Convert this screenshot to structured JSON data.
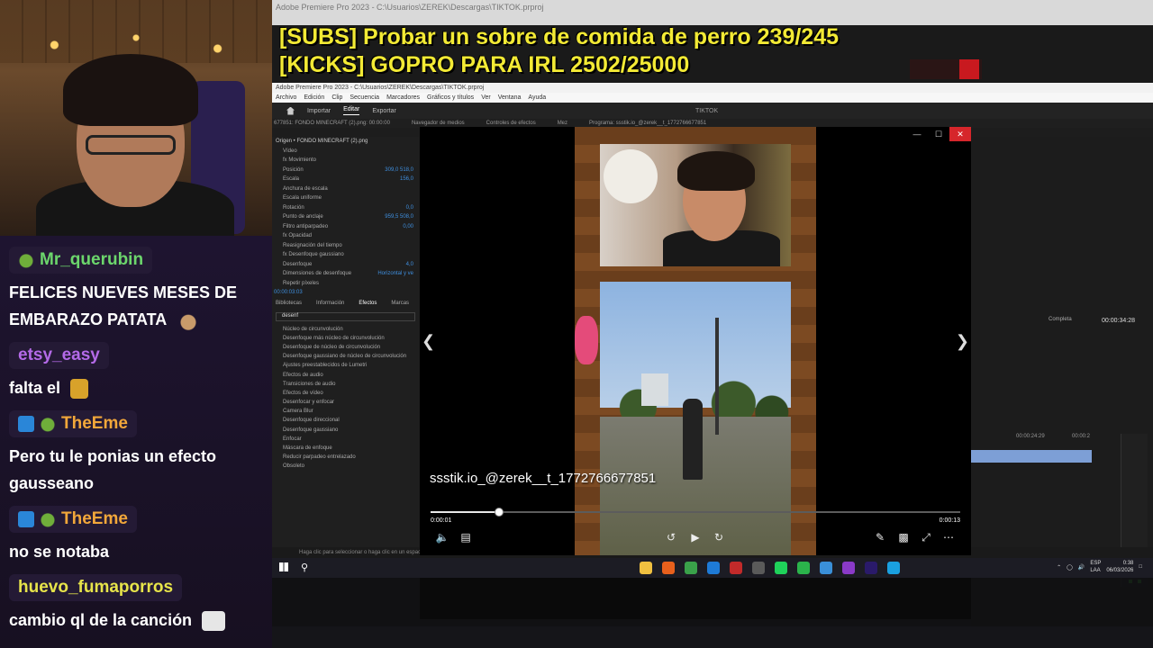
{
  "alerts": {
    "line1": "[SUBS] Probar un sobre de comida de perro 239/245",
    "line2": "[KICKS] GOPRO PARA IRL 2502/25000"
  },
  "chat": {
    "messages": [
      {
        "user": "Mr_querubin",
        "color": "#6cd66c",
        "badges": [
          "frog"
        ],
        "text": "FELICES NUEVES MESES DE EMBARAZO PATATA"
      },
      {
        "user": "etsy_easy",
        "color": "#b46ae8",
        "badges": [],
        "text": "falta el"
      },
      {
        "user": "TheEme",
        "color": "#f2a73a",
        "badges": [
          "prime",
          "frog"
        ],
        "text": "Pero tu le ponias un efecto gausseano"
      },
      {
        "user": "TheEme",
        "color": "#f2a73a",
        "badges": [
          "prime",
          "frog"
        ],
        "text": "no se notaba"
      },
      {
        "user": "huevo_fumaporros",
        "color": "#e7e44a",
        "badges": [],
        "text": "cambio ql de la canción"
      }
    ]
  },
  "premiere": {
    "title": "Adobe Premiere Pro 2023 - C:\\Usuarios\\ZEREK\\Descargas\\TIKTOK.prproj",
    "menu": [
      "Archivo",
      "Edición",
      "Clip",
      "Secuencia",
      "Marcadores",
      "Gráficos y títulos",
      "Ver",
      "Ventana",
      "Ayuda"
    ],
    "tabs": [
      "Importar",
      "Editar",
      "Exportar"
    ],
    "active_tab": "Editar",
    "project_name": "TIKTOK",
    "panels": [
      "677851: FONDO MINECRAFT (2).png: 00:00:00",
      "Navegador de medios",
      "Controles de efectos",
      "Mez",
      "Programa: ssstik.io_@zerek__t_1772766677851"
    ],
    "source_label": "Origen • FONDO MINECRAFT (2).png",
    "effect_rows": [
      {
        "label": "Vídeo",
        "value": ""
      },
      {
        "label": "fx  Movimiento",
        "value": ""
      },
      {
        "label": "Posición",
        "value": "309,0   518,0"
      },
      {
        "label": "Escala",
        "value": "156,0"
      },
      {
        "label": "Anchura de escala",
        "value": ""
      },
      {
        "label": "Escala uniforme",
        "value": ""
      },
      {
        "label": "Rotación",
        "value": "0,0"
      },
      {
        "label": "Punto de anclaje",
        "value": "959,5   508,0"
      },
      {
        "label": "Filtro antiparpadeo",
        "value": "0,00"
      },
      {
        "label": "fx  Opacidad",
        "value": ""
      },
      {
        "label": "Reasignación del tiempo",
        "value": ""
      },
      {
        "label": "fx  Desenfoque gaussiano",
        "value": ""
      },
      {
        "label": "Desenfoque",
        "value": "4,0"
      },
      {
        "label": "Dimensiones de desenfoque",
        "value": "Horizontal y ve"
      },
      {
        "label": "Repetir píxeles",
        "value": ""
      }
    ],
    "effects_tabs": [
      "Bibliotecas",
      "Información",
      "Efectos",
      "Marcas"
    ],
    "effects_search": "desenf",
    "effects_tree": [
      "Núcleo de circunvolución",
      "Desenfoque más núcleo de circunvolución",
      "Desenfoque de núcleo de circunvolución",
      "Desenfoque gaussiano de núcleo de circunvolución",
      "Ajustes preestablecidos de Lumetri",
      "Efectos de audio",
      "Transiciones de audio",
      "Efectos de vídeo",
      "Desenfocar y enfocar",
      "Camera Blur",
      "Desenfoque direccional",
      "Desenfoque gaussiano",
      "Enfocar",
      "Máscara de enfoque",
      "Reducir parpadeo entrelazado",
      "Obsoleto"
    ],
    "timecode_small": "00:00:03:03",
    "status_text": "Haga clic para seleccionar o haga clic en un espacio vacío y arrastre para seleccionar un recuadro.",
    "complete_label": "Completa",
    "program_timecode": "00:00:34:28",
    "ruler": [
      "00:00:24:29",
      "00:00:2"
    ]
  },
  "viewer": {
    "caption": "ssstik.io_@zerek__t_1772766677851",
    "time_current": "0:00:01",
    "time_total": "0:00:13",
    "progress": 0.13,
    "controls": {
      "minimize": "—",
      "maximize": "☐",
      "close": "✕"
    }
  },
  "taskbar": {
    "lang": "ESP",
    "lang2": "LAA",
    "time": "0:38",
    "date": "06/03/2026",
    "app_colors": [
      "#f0c040",
      "#e8601c",
      "#3aa14a",
      "#1e7ad6",
      "#c22a2a",
      "#5a5a5a",
      "#1fd15a",
      "#2bb34b",
      "#3a8fd8",
      "#8a3ac8",
      "#2a1a6a",
      "#1aa0e0"
    ]
  }
}
